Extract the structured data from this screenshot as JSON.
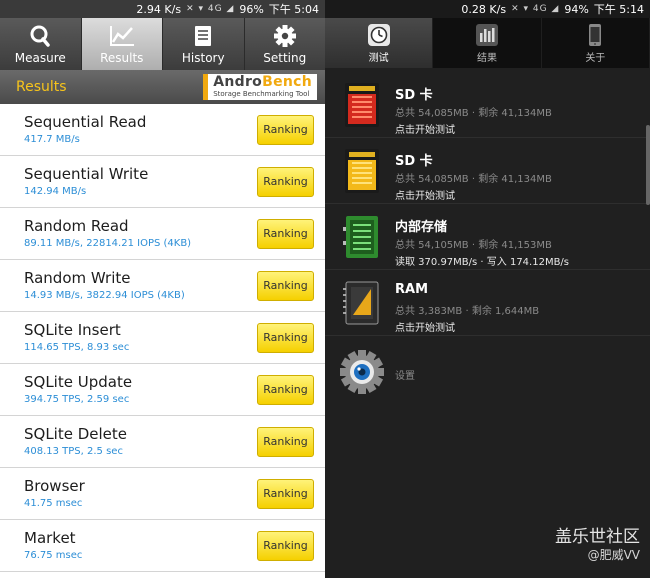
{
  "left": {
    "status": {
      "speed": "2.94 K/s",
      "network": "4G",
      "battery": "96%",
      "time": "下午 5:04"
    },
    "tabs": [
      {
        "label": "Measure",
        "icon": "search-icon"
      },
      {
        "label": "Results",
        "icon": "graph-icon"
      },
      {
        "label": "History",
        "icon": "history-icon"
      },
      {
        "label": "Setting",
        "icon": "gear-icon"
      }
    ],
    "active_tab": "Results",
    "header_title": "Results",
    "logo": {
      "part1": "Andro",
      "part2": "Bench",
      "tagline": "Storage Benchmarking Tool"
    },
    "rows": [
      {
        "name": "Sequential Read",
        "value": "417.7 MB/s",
        "button": "Ranking"
      },
      {
        "name": "Sequential Write",
        "value": "142.94 MB/s",
        "button": "Ranking"
      },
      {
        "name": "Random Read",
        "value": "89.11 MB/s, 22814.21 IOPS (4KB)",
        "button": "Ranking"
      },
      {
        "name": "Random Write",
        "value": "14.93 MB/s, 3822.94 IOPS (4KB)",
        "button": "Ranking"
      },
      {
        "name": "SQLite Insert",
        "value": "114.65 TPS, 8.93 sec",
        "button": "Ranking"
      },
      {
        "name": "SQLite Update",
        "value": "394.75 TPS, 2.59 sec",
        "button": "Ranking"
      },
      {
        "name": "SQLite Delete",
        "value": "408.13 TPS, 2.5 sec",
        "button": "Ranking"
      },
      {
        "name": "Browser",
        "value": "41.75 msec",
        "button": "Ranking"
      },
      {
        "name": "Market",
        "value": "76.75 msec",
        "button": "Ranking"
      }
    ]
  },
  "right": {
    "status": {
      "speed": "0.28 K/s",
      "network": "4G",
      "battery": "94%",
      "time": "下午 5:14"
    },
    "tabs": [
      {
        "label": "测试",
        "icon": "clock-gauge-icon"
      },
      {
        "label": "结果",
        "icon": "bar-chart-icon"
      },
      {
        "label": "关于",
        "icon": "phone-icon"
      }
    ],
    "items": [
      {
        "title": "SD 卡",
        "subtitle": "总共 54,085MB · 剩余 41,134MB",
        "action": "点击开始测试",
        "icon": "sd-card-red-icon"
      },
      {
        "title": "SD 卡",
        "subtitle": "总共 54,085MB · 剩余 41,134MB",
        "action": "点击开始测试",
        "icon": "sd-card-yellow-icon"
      },
      {
        "title": "内部存储",
        "subtitle": "总共 54,105MB · 剩余 41,153MB",
        "action": "读取 370.97MB/s · 写入 174.12MB/s",
        "icon": "internal-storage-icon"
      },
      {
        "title": "RAM",
        "subtitle": "总共 3,383MB · 剩余 1,644MB",
        "action": "点击开始测试",
        "icon": "ram-chip-icon"
      }
    ],
    "settings_label": "设置",
    "watermark": {
      "line1": "盖乐世社区",
      "line2": "@肥威VV"
    }
  }
}
